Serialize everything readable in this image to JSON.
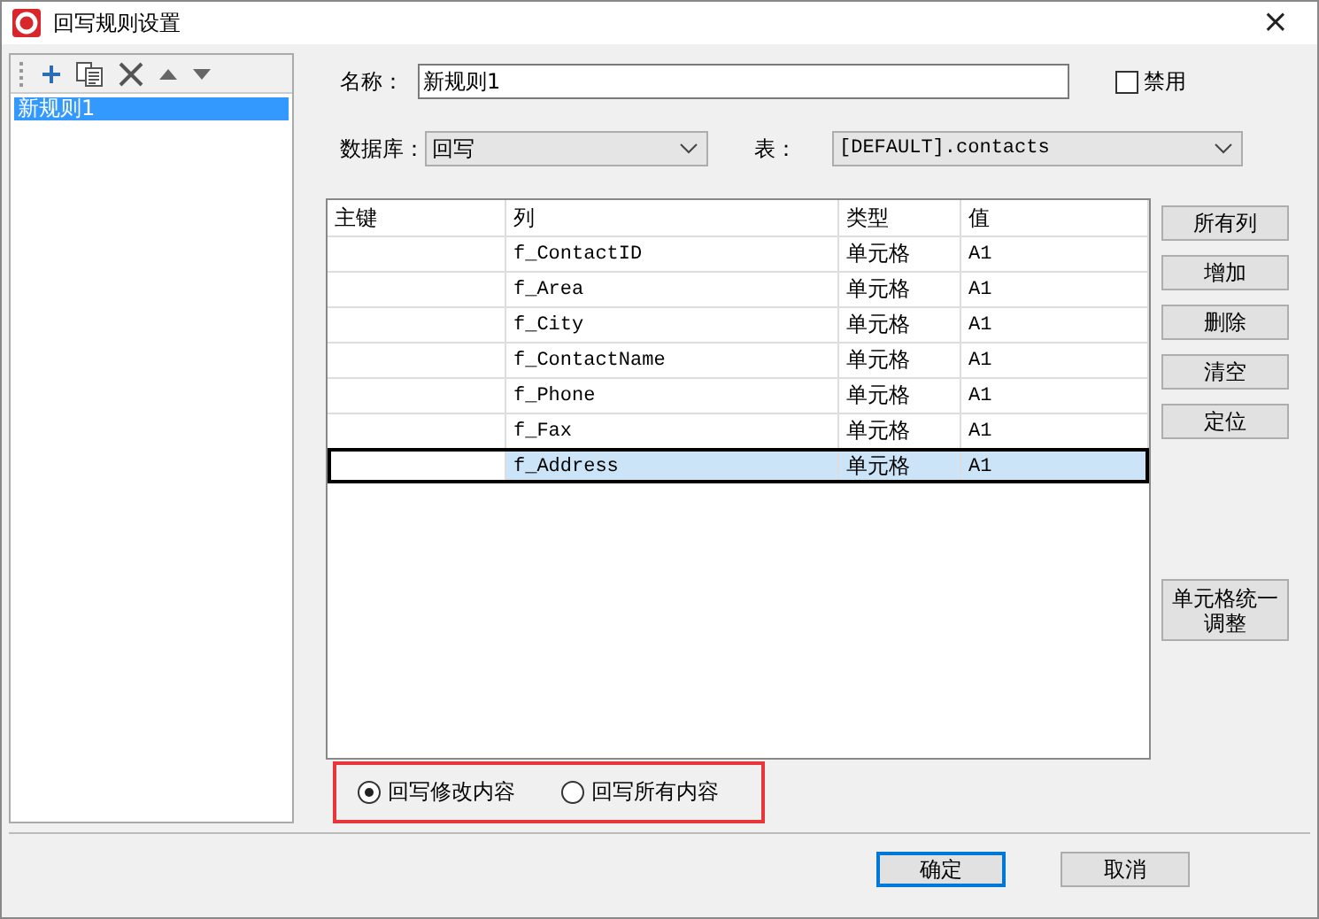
{
  "window": {
    "title": "回写规则设置",
    "close": "×"
  },
  "rules": [
    {
      "label": "新规则1",
      "selected": true
    }
  ],
  "name_field": {
    "label": "名称：",
    "value": "新规则1"
  },
  "disable_checkbox": {
    "label": "禁用",
    "checked": false
  },
  "database": {
    "label": "数据库：",
    "value": "回写"
  },
  "table_select": {
    "label": "表：",
    "value": "[DEFAULT].contacts"
  },
  "grid": {
    "columns": [
      "主键",
      "列",
      "类型",
      "值"
    ],
    "rows": [
      {
        "cells": [
          "",
          "f_ContactID",
          "单元格",
          "A1"
        ],
        "selected": false
      },
      {
        "cells": [
          "",
          "f_Area",
          "单元格",
          "A1"
        ],
        "selected": false
      },
      {
        "cells": [
          "",
          "f_City",
          "单元格",
          "A1"
        ],
        "selected": false
      },
      {
        "cells": [
          "",
          "f_ContactName",
          "单元格",
          "A1"
        ],
        "selected": false
      },
      {
        "cells": [
          "",
          "f_Phone",
          "单元格",
          "A1"
        ],
        "selected": false
      },
      {
        "cells": [
          "",
          "f_Fax",
          "单元格",
          "A1"
        ],
        "selected": false
      },
      {
        "cells": [
          "",
          "f_Address",
          "单元格",
          "A1"
        ],
        "selected": true
      }
    ]
  },
  "side_buttons": [
    "所有列",
    "增加",
    "删除",
    "清空",
    "定位"
  ],
  "unify_button": "单元格统一调整",
  "write_mode": [
    {
      "label": "回写修改内容",
      "selected": true
    },
    {
      "label": "回写所有内容",
      "selected": false
    }
  ],
  "footer_buttons": [
    {
      "label": "确定",
      "focused": true
    },
    {
      "label": "取消",
      "focused": false
    }
  ]
}
